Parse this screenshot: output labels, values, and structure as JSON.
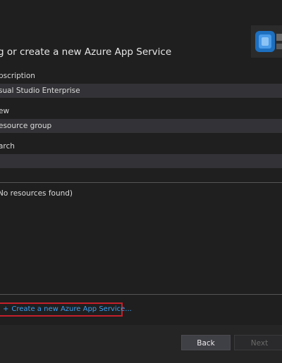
{
  "header": {
    "title": "g or create a new Azure App Service",
    "icon": "azure-app-service-icon"
  },
  "subscription": {
    "label": "bscription",
    "value": "sual Studio Enterprise"
  },
  "view": {
    "label": "ew",
    "value": "esource group"
  },
  "search": {
    "label": "arch",
    "value": ""
  },
  "results": {
    "empty_text": "No resources found)"
  },
  "create": {
    "label": "Create a new Azure App Service..."
  },
  "footer": {
    "back_label": "Back",
    "next_label": "Next"
  },
  "colors": {
    "accent_link": "#3aa0f3",
    "highlight_border": "#c4202b"
  }
}
